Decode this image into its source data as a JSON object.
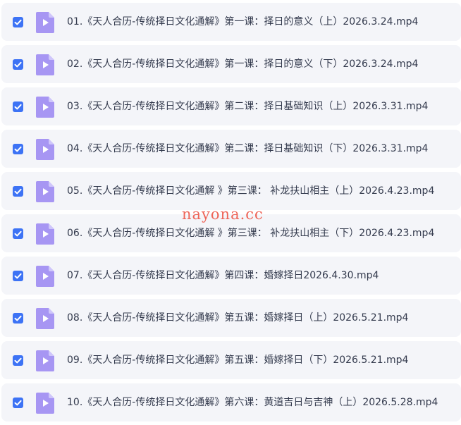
{
  "files": [
    {
      "name": "01.《天人合历-传统择日文化通解》第一课：择日的意义（上）2026.3.24.mp4",
      "checked": true
    },
    {
      "name": "02.《天人合历-传统择日文化通解》第一课：择日的意义（下）2026.3.24.mp4",
      "checked": true
    },
    {
      "name": "03.《天人合历-传统择日文化通解》第二课：择日基础知识（上）2026.3.31.mp4",
      "checked": true
    },
    {
      "name": "04.《天人合历-传统择日文化通解》第二课：择日基础知识（下）2026.3.31.mp4",
      "checked": true
    },
    {
      "name": "05.《天人合历-传统择日文化通解 》第三课： 补龙扶山相主（上）2026.4.23.mp4",
      "checked": true
    },
    {
      "name": "06.《天人合历-传统择日文化通解 》第三课： 补龙扶山相主（下）2026.4.23.mp4",
      "checked": true
    },
    {
      "name": "07.《天人合历-传统择日文化通解》第四课：婚嫁择日2026.4.30.mp4",
      "checked": true
    },
    {
      "name": "08.《天人合历-传统择日文化通解》第五课：婚嫁择日（上）2026.5.21.mp4",
      "checked": true
    },
    {
      "name": "09.《天人合历-传统择日文化通解》第五课：婚嫁择日（下）2026.5.21.mp4",
      "checked": true
    },
    {
      "name": "10.《天人合历-传统择日文化通解》第六课：黄道吉日与吉神（上）2026.5.28.mp4",
      "checked": true
    }
  ],
  "watermark": "nayona.cc",
  "colors": {
    "row_background": "#f4f5f9",
    "checkbox": "#3d73f5",
    "file_icon": "#a796f3",
    "text": "#333a4d",
    "watermark": "#ee5d4f"
  },
  "icons": {
    "checkbox": "checkmark-icon",
    "file": "video-file-play-icon"
  }
}
